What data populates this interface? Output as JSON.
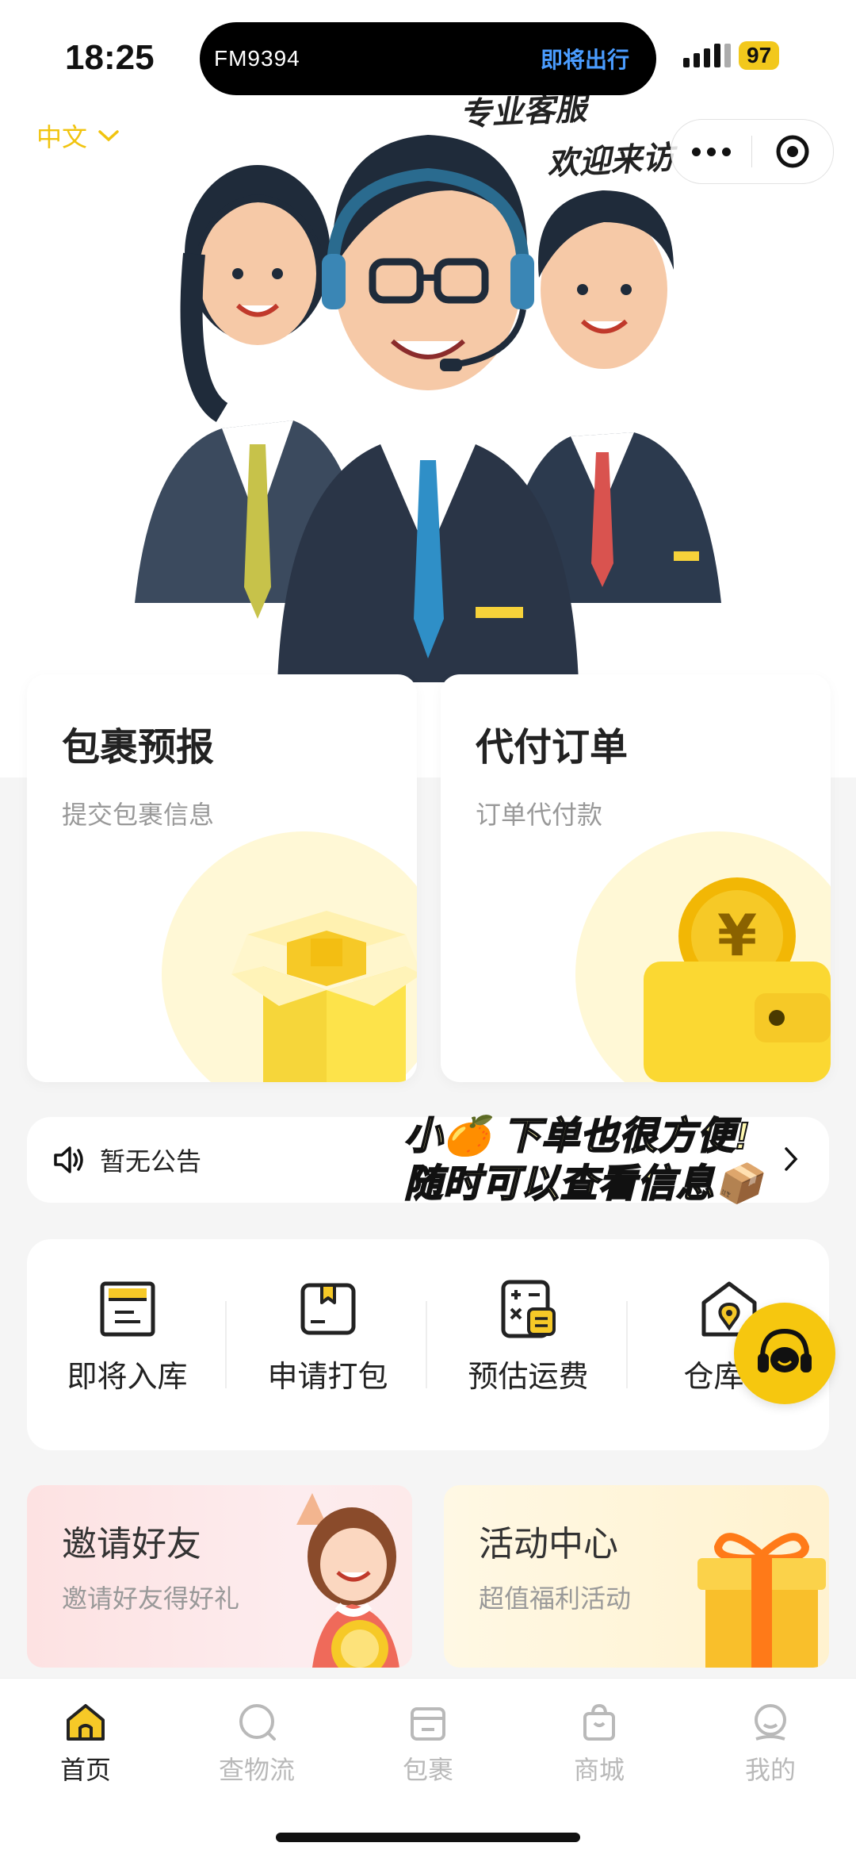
{
  "status_bar": {
    "time": "18:25",
    "island_left": "FM9394",
    "island_right": "即将出行",
    "battery": "97"
  },
  "header": {
    "language": "中文",
    "hero_caption_1": "专业客服",
    "hero_caption_2": "欢迎来访"
  },
  "service_cards": [
    {
      "title": "包裹预报",
      "subtitle": "提交包裹信息"
    },
    {
      "title": "代付订单",
      "subtitle": "订单代付款"
    }
  ],
  "notice": {
    "text": "暂无公告",
    "overlay_line_1": "小🍊 下单也很方便!",
    "overlay_line_2": "随时可以查看信息📦"
  },
  "quick_actions": [
    {
      "label": "即将入库",
      "icon": "inbound-warehouse-icon"
    },
    {
      "label": "申请打包",
      "icon": "package-box-icon"
    },
    {
      "label": "预估运费",
      "icon": "calculator-icon"
    },
    {
      "label": "仓库地",
      "icon": "warehouse-location-icon"
    }
  ],
  "promos": [
    {
      "title": "邀请好友",
      "subtitle": "邀请好友得好礼"
    },
    {
      "title": "活动中心",
      "subtitle": "超值福利活动"
    }
  ],
  "tabbar": [
    {
      "label": "首页",
      "active": true
    },
    {
      "label": "查物流",
      "active": false
    },
    {
      "label": "包裹",
      "active": false
    },
    {
      "label": "商城",
      "active": false
    },
    {
      "label": "我的",
      "active": false
    }
  ],
  "colors": {
    "accent": "#f6c70f",
    "island_link": "#4a9cff",
    "muted": "#999999"
  }
}
